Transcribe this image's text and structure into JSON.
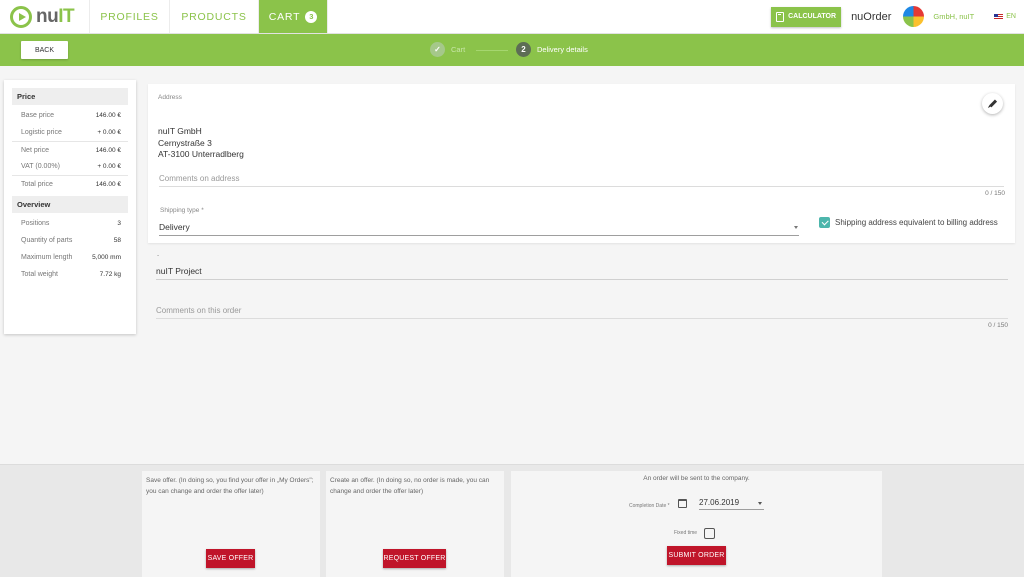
{
  "nav": {
    "logo_prefix": "nu",
    "logo_accent": "IT",
    "profiles": "PROFILES",
    "products": "PRODUCTS",
    "cart": "CART",
    "cart_count": "3",
    "calculator": "CALCULATOR",
    "app_name": "nuOrder",
    "company": "GmbH, nuIT",
    "language": "EN"
  },
  "steps": {
    "back": "BACK",
    "step1_label": "Cart",
    "step2_number": "2",
    "step2_label": "Delivery details"
  },
  "summary": {
    "price_header": "Price",
    "price_rows": [
      {
        "label": "Base price",
        "value": "146.00 €"
      },
      {
        "label": "Logistic price",
        "value": "+ 0.00 €"
      },
      {
        "label": "Net price",
        "value": "146.00 €"
      },
      {
        "label": "VAT (0.00%)",
        "value": "+ 0.00 €"
      },
      {
        "label": "Total price",
        "value": "146.00 €"
      }
    ],
    "overview_header": "Overview",
    "overview_rows": [
      {
        "label": "Positions",
        "value": "3"
      },
      {
        "label": "Quantity of parts",
        "value": "58"
      },
      {
        "label": "Maximum length",
        "value": "5,000 mm"
      },
      {
        "label": "Total weight",
        "value": "7.72 kg"
      }
    ]
  },
  "address": {
    "label": "Address",
    "lines": [
      "nuIT GmbH",
      "Cernystraße 3",
      "AT-3100 Unterradlberg"
    ],
    "comment_placeholder": "Comments on address",
    "counter": "0 / 150",
    "shipping_label": "Shipping type *",
    "shipping_value": "Delivery",
    "equivalent_label": "Shipping address equivalent to billing address"
  },
  "project": {
    "dash": "-",
    "value": "nuIT Project",
    "comment_placeholder": "Comments on this order",
    "counter": "0 / 150"
  },
  "footer": {
    "save_text": "Save offer. (In doing so, you find your offer in „My Orders\"; you can change and order the offer later)",
    "save_button": "SAVE OFFER",
    "request_text": "Create an offer. (In doing so, no order is made, you can change and order the offer later)",
    "request_button": "REQUEST OFFER",
    "order_note": "An order will be sent to the company.",
    "completion_label": "Completion Date *",
    "completion_date": "27.06.2019",
    "fixed_time_label": "Fixed time",
    "submit_button": "SUBMIT ORDER"
  },
  "colors": {
    "brand_green": "#8bc34a",
    "button_red": "#c0152a",
    "check_teal": "#4db6ac"
  },
  "icons": [
    "logo-icon",
    "calculator-icon",
    "avatar",
    "flag-icon",
    "check-icon",
    "pencil-icon",
    "calendar-icon",
    "chevron-down-icon"
  ]
}
